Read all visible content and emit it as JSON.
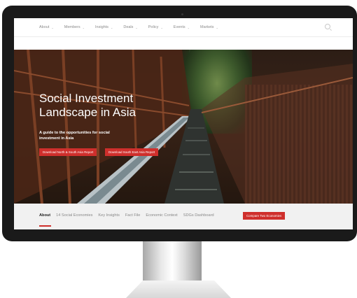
{
  "nav": {
    "items": [
      "About",
      "Members",
      "Insights",
      "Deals",
      "Policy",
      "Events",
      "Markets"
    ]
  },
  "hero": {
    "title_line1": "Social Investment",
    "title_line2": "Landscape in Asia",
    "subtitle_line1": "A guide to the opportunities for social",
    "subtitle_line2": "investment in Asia",
    "btn1_label": "Download North & South Asia Report",
    "btn2_label": "Download South East Asia Report"
  },
  "subnav": {
    "items": [
      "About",
      "14 Social Economies",
      "Key Insights",
      "Fact File",
      "Economic Context",
      "SDGs Dashboard"
    ],
    "active": "About",
    "compare_label": "Compare Two Economies"
  },
  "colors": {
    "accent": "#cf2f2c",
    "bezel": "#1a1a1a",
    "subnav_bg": "#f1f1f1"
  },
  "icons": {
    "search": "search-icon",
    "chevron": "chevron-down-icon"
  }
}
